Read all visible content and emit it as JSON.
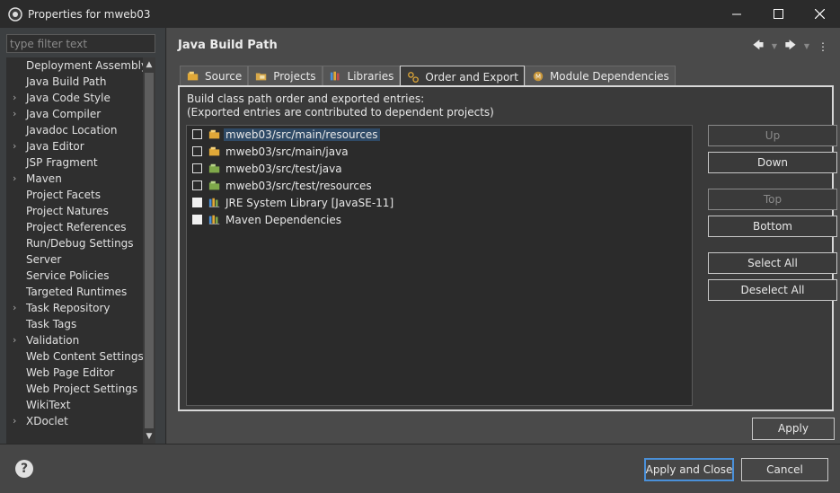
{
  "window": {
    "title": "Properties for mweb03"
  },
  "sidebar": {
    "filter_placeholder": "type filter text",
    "items": [
      {
        "label": "Deployment Assembly",
        "expandable": false
      },
      {
        "label": "Java Build Path",
        "expandable": false
      },
      {
        "label": "Java Code Style",
        "expandable": true
      },
      {
        "label": "Java Compiler",
        "expandable": true
      },
      {
        "label": "Javadoc Location",
        "expandable": false
      },
      {
        "label": "Java Editor",
        "expandable": true
      },
      {
        "label": "JSP Fragment",
        "expandable": false
      },
      {
        "label": "Maven",
        "expandable": true
      },
      {
        "label": "Project Facets",
        "expandable": false
      },
      {
        "label": "Project Natures",
        "expandable": false
      },
      {
        "label": "Project References",
        "expandable": false
      },
      {
        "label": "Run/Debug Settings",
        "expandable": false
      },
      {
        "label": "Server",
        "expandable": false
      },
      {
        "label": "Service Policies",
        "expandable": false
      },
      {
        "label": "Targeted Runtimes",
        "expandable": false
      },
      {
        "label": "Task Repository",
        "expandable": true
      },
      {
        "label": "Task Tags",
        "expandable": false
      },
      {
        "label": "Validation",
        "expandable": true
      },
      {
        "label": "Web Content Settings",
        "expandable": false
      },
      {
        "label": "Web Page Editor",
        "expandable": false
      },
      {
        "label": "Web Project Settings",
        "expandable": false
      },
      {
        "label": "WikiText",
        "expandable": false
      },
      {
        "label": "XDoclet",
        "expandable": true
      }
    ]
  },
  "main": {
    "title": "Java Build Path",
    "tabs": [
      {
        "label": "Source",
        "icon": "source-folder-icon"
      },
      {
        "label": "Projects",
        "icon": "projects-icon"
      },
      {
        "label": "Libraries",
        "icon": "libraries-icon"
      },
      {
        "label": "Order and Export",
        "icon": "order-export-icon"
      },
      {
        "label": "Module Dependencies",
        "icon": "module-icon"
      }
    ],
    "description_line1": "Build class path order and exported entries:",
    "description_line2": "(Exported entries are contributed to dependent projects)",
    "entries": [
      {
        "label": "mweb03/src/main/resources",
        "icon": "source-folder-icon",
        "checked": false,
        "selected": true
      },
      {
        "label": "mweb03/src/main/java",
        "icon": "source-folder-icon",
        "checked": false,
        "selected": false
      },
      {
        "label": "mweb03/src/test/java",
        "icon": "test-folder-icon",
        "checked": false,
        "selected": false
      },
      {
        "label": "mweb03/src/test/resources",
        "icon": "test-folder-icon",
        "checked": false,
        "selected": false
      },
      {
        "label": "JRE System Library [JavaSE-11]",
        "icon": "library-icon",
        "checked": true,
        "selected": false
      },
      {
        "label": "Maven Dependencies",
        "icon": "library-icon",
        "checked": true,
        "selected": false
      }
    ],
    "buttons": {
      "up": "Up",
      "down": "Down",
      "top": "Top",
      "bottom": "Bottom",
      "select_all": "Select All",
      "deselect_all": "Deselect All"
    },
    "apply": "Apply"
  },
  "footer": {
    "apply_close": "Apply and Close",
    "cancel": "Cancel"
  }
}
